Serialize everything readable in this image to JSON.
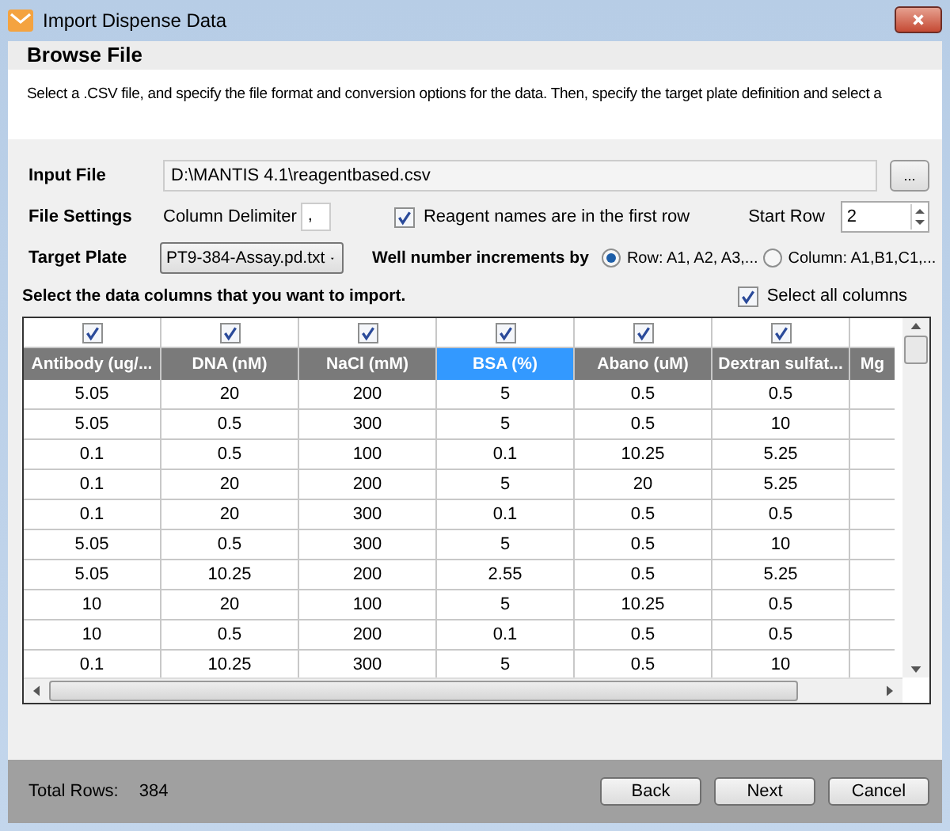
{
  "window": {
    "title": "Import Dispense Data"
  },
  "header": {
    "title": "Browse File",
    "description": "Select a .CSV file, and specify the file format and conversion options for the data. Then, specify the target plate definition and select a"
  },
  "input_file": {
    "label": "Input File",
    "value": "D:\\MANTIS 4.1\\reagentbased.csv",
    "browse_button": "..."
  },
  "file_settings": {
    "label": "File Settings",
    "delimiter_label": "Column Delimiter",
    "delimiter_value": ",",
    "first_row_checkbox": {
      "label": "Reagent names are in the first row",
      "checked": true
    },
    "start_row_label": "Start Row",
    "start_row_value": "2"
  },
  "target_plate": {
    "label": "Target Plate",
    "value": "PT9-384-Assay.pd.txt",
    "increment_label": "Well number increments by",
    "options": [
      {
        "label": "Row: A1, A2, A3,...",
        "selected": true
      },
      {
        "label": "Column: A1,B1,C1,...",
        "selected": false
      }
    ]
  },
  "columns_section": {
    "prompt": "Select the data columns that you want to import.",
    "select_all": {
      "label": "Select all columns",
      "checked": true
    }
  },
  "table": {
    "columns": [
      {
        "label": "Antibody (ug/...",
        "checked": true,
        "selected": false
      },
      {
        "label": "DNA (nM)",
        "checked": true,
        "selected": false
      },
      {
        "label": "NaCl (mM)",
        "checked": true,
        "selected": false
      },
      {
        "label": "BSA (%)",
        "checked": true,
        "selected": true
      },
      {
        "label": "Abano (uM)",
        "checked": true,
        "selected": false
      },
      {
        "label": "Dextran sulfat...",
        "checked": true,
        "selected": false
      },
      {
        "label": "Mg",
        "selected": false
      }
    ],
    "rows": [
      [
        "5.05",
        "20",
        "200",
        "5",
        "0.5",
        "0.5"
      ],
      [
        "5.05",
        "0.5",
        "300",
        "5",
        "0.5",
        "10"
      ],
      [
        "0.1",
        "0.5",
        "100",
        "0.1",
        "10.25",
        "5.25"
      ],
      [
        "0.1",
        "20",
        "200",
        "5",
        "20",
        "5.25"
      ],
      [
        "0.1",
        "20",
        "300",
        "0.1",
        "0.5",
        "0.5"
      ],
      [
        "5.05",
        "0.5",
        "300",
        "5",
        "0.5",
        "10"
      ],
      [
        "5.05",
        "10.25",
        "200",
        "2.55",
        "0.5",
        "5.25"
      ],
      [
        "10",
        "20",
        "100",
        "5",
        "10.25",
        "0.5"
      ],
      [
        "10",
        "0.5",
        "200",
        "0.1",
        "0.5",
        "0.5"
      ],
      [
        "0.1",
        "10.25",
        "300",
        "5",
        "0.5",
        "10"
      ]
    ]
  },
  "footer": {
    "total_label": "Total Rows:",
    "total_value": "384",
    "buttons": [
      "Back",
      "Next",
      "Cancel"
    ]
  }
}
